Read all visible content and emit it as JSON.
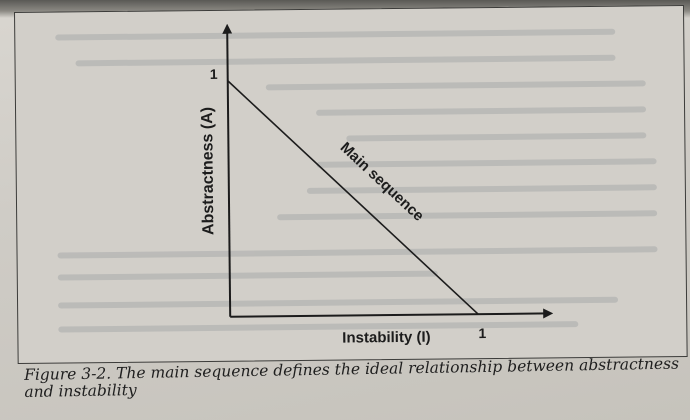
{
  "figure": {
    "caption": "Figure 3-2. The main sequence defines the ideal relationship between abstractness and instability"
  },
  "chart_data": {
    "type": "line",
    "title": "",
    "xlabel": "Instability (I)",
    "ylabel": "Abstractness (A)",
    "xlim": [
      0,
      1
    ],
    "ylim": [
      0,
      1
    ],
    "x_tick_labels": [
      "1"
    ],
    "y_tick_labels": [
      "1"
    ],
    "series": [
      {
        "name": "Main sequence",
        "x": [
          0,
          1
        ],
        "y": [
          1,
          0
        ]
      }
    ],
    "grid": false,
    "legend": "none"
  },
  "colors": {
    "ink": "#1c1c1c",
    "paper": "#d2cfc9"
  }
}
